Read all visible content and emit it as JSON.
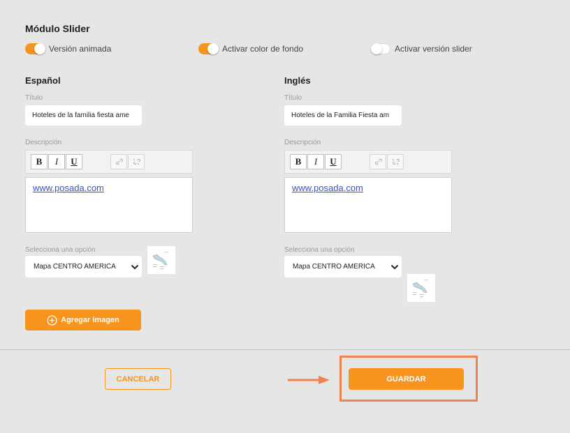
{
  "module": {
    "title": "Módulo Slider",
    "toggles": [
      {
        "label": "Versión animada",
        "on": true
      },
      {
        "label": "Activar color de fondo",
        "on": true
      },
      {
        "label": "Activar versión slider",
        "on": false
      }
    ]
  },
  "spanish": {
    "heading": "Español",
    "title_label": "Título",
    "title_value": "Hoteles de la familia fiesta ame",
    "desc_label": "Descripción",
    "toolbar": {
      "bold": "B",
      "italic": "I",
      "underline": "U"
    },
    "desc_link": "www.posada.com",
    "select_label": "Selecciona una opción",
    "select_value": "Mapa CENTRO AMERICA"
  },
  "english": {
    "heading": "Inglés",
    "title_label": "Título",
    "title_value": "Hoteles de la Familia Fiesta am",
    "desc_label": "Descripción",
    "toolbar": {
      "bold": "B",
      "italic": "I",
      "underline": "U"
    },
    "desc_link": "www.posada.com",
    "select_label": "Selecciona una opción",
    "select_value": "Mapa CENTRO AMERICA"
  },
  "add_image_label": "Agregar imagen",
  "footer": {
    "cancel_label": "CANCELAR",
    "save_label": "GUARDAR"
  },
  "colors": {
    "accent": "#f7941d",
    "background": "#e6e6e6",
    "highlight": "#f0834d",
    "link": "#3a53c7"
  }
}
